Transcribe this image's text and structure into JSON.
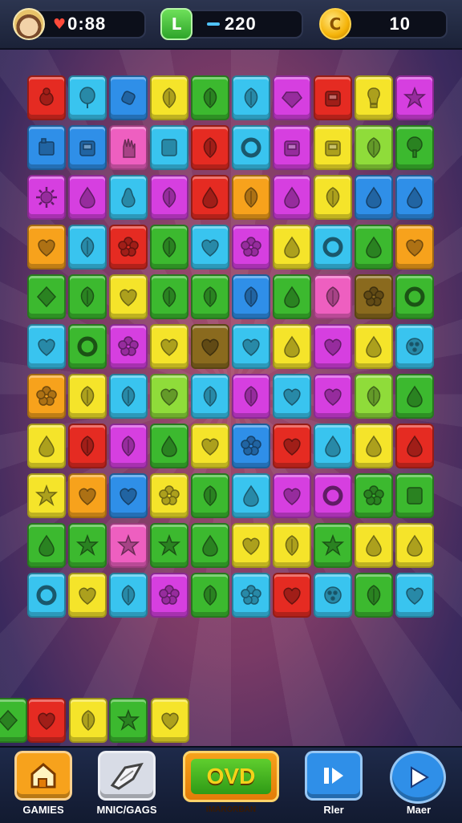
{
  "topbar": {
    "lives": "0:88",
    "score": "220",
    "coins": "10",
    "level_icon_letter": "L",
    "coin_icon_letter": "C"
  },
  "palette": {
    "r": "#e52b22",
    "b": "#2f8fe8",
    "c": "#39c4ef",
    "y": "#f5e42a",
    "g": "#3cb92f",
    "l": "#8fdc3a",
    "m": "#d63fe0",
    "p": "#ee5fc0",
    "o": "#f7a21c",
    "t": "#2ec1cf",
    "n": "#8a6a1e"
  },
  "board": {
    "rows": [
      [
        "r",
        "c",
        "b",
        "y",
        "g",
        "c",
        "m",
        "r",
        "y",
        "m"
      ],
      [
        "b",
        "b",
        "p",
        "c",
        "r",
        "c",
        "m",
        "y",
        "l",
        "g"
      ],
      [
        "m",
        "m",
        "c",
        "m",
        "r",
        "o",
        "m",
        "y",
        "b",
        "b"
      ],
      [
        "o",
        "c",
        "r",
        "g",
        "c",
        "m",
        "y",
        "c",
        "g",
        "o"
      ],
      [
        "g",
        "g",
        "y",
        "g",
        "g",
        "b",
        "g",
        "p",
        "n",
        "g"
      ],
      [
        "c",
        "g",
        "m",
        "y",
        "n",
        "c",
        "y",
        "m",
        "y",
        "c"
      ],
      [
        "o",
        "y",
        "c",
        "l",
        "c",
        "m",
        "c",
        "m",
        "l",
        "g"
      ],
      [
        "y",
        "r",
        "m",
        "g",
        "y",
        "b",
        "r",
        "c",
        "y",
        "r"
      ],
      [
        "y",
        "o",
        "b",
        "y",
        "g",
        "c",
        "m",
        "m",
        "g",
        "g"
      ],
      [
        "g",
        "g",
        "p",
        "g",
        "g",
        "y",
        "y",
        "g",
        "y",
        "y"
      ],
      [
        "c",
        "y",
        "c",
        "m",
        "g",
        "c",
        "r",
        "c",
        "g",
        "c"
      ]
    ],
    "partial_row": [
      "g",
      "r",
      "y",
      "g",
      "y"
    ],
    "icons": [
      [
        "bug",
        "balloon",
        "candy",
        "leaf",
        "leaf",
        "leaf",
        "gem",
        "box",
        "bulb",
        "star"
      ],
      [
        "block",
        "box",
        "hand",
        "square",
        "leaf",
        "ring",
        "box",
        "box",
        "leaf",
        "tree"
      ],
      [
        "sun",
        "drop",
        "pear",
        "leaf",
        "drop",
        "leaf",
        "drop",
        "leaf",
        "drop",
        "drop"
      ],
      [
        "heart",
        "leaf",
        "flower",
        "leaf",
        "heart",
        "flower",
        "drop",
        "ring",
        "drop",
        "heart"
      ],
      [
        "diamond",
        "leaf",
        "heart",
        "leaf",
        "leaf",
        "leaf",
        "drop",
        "leaf",
        "flower",
        "ring"
      ],
      [
        "heart",
        "ring",
        "flower",
        "heart",
        "heart",
        "heart",
        "drop",
        "heart",
        "drop",
        "dots"
      ],
      [
        "flower",
        "leaf",
        "leaf",
        "heart",
        "leaf",
        "leaf",
        "heart",
        "heart",
        "leaf",
        "drop"
      ],
      [
        "drop",
        "leaf",
        "leaf",
        "drop",
        "heart",
        "flower",
        "heart",
        "drop",
        "drop",
        "drop"
      ],
      [
        "star",
        "heart",
        "heart",
        "flower",
        "leaf",
        "drop",
        "heart",
        "ring",
        "flower",
        "square"
      ],
      [
        "drop",
        "star",
        "star",
        "star",
        "drop",
        "heart",
        "leaf",
        "star",
        "drop",
        "drop"
      ],
      [
        "ring",
        "heart",
        "leaf",
        "flower",
        "leaf",
        "flower",
        "heart",
        "dots",
        "leaf",
        "heart"
      ]
    ],
    "partial_icons": [
      "diamond",
      "heart",
      "leaf",
      "star",
      "heart"
    ]
  },
  "bottombar": {
    "games_label": "GAMIES",
    "music_label": "MNIC/GAGS",
    "center_text": "OVD",
    "center_label": "IMARORBAN",
    "play_label": "Rler",
    "next_label": "Maer",
    "colors": {
      "games": "#f7a21c",
      "music": "#d8dce6",
      "play": "#2f8fe8",
      "next": "#2f8fe8"
    }
  }
}
